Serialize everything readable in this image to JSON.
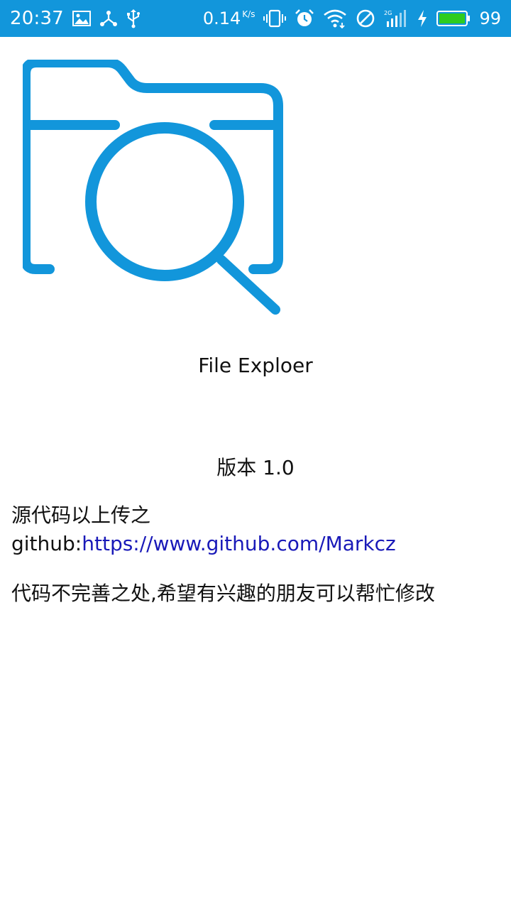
{
  "status_bar": {
    "time": "20:37",
    "net_speed_value": "0.14",
    "net_speed_unit": "K/s",
    "battery_percent": "99",
    "icons": [
      "image-icon",
      "share-icon",
      "usb-icon",
      "vibrate-icon",
      "alarm-icon",
      "wifi-icon",
      "blocked-icon",
      "signal-icon",
      "charging-icon",
      "battery-icon"
    ],
    "color": "#1296db",
    "battery_color": "#2ecc1f"
  },
  "about": {
    "app_name": "File Exploer",
    "version": "版本 1.0",
    "source_prefix": "源代码以上传之github:",
    "source_link": "https://www.github.com/Markcz",
    "note": "代码不完善之处,希望有兴趣的朋友可以帮忙修改",
    "logo_icon": "folder-search-icon",
    "logo_color": "#1296db",
    "link_color": "#1919b8"
  }
}
